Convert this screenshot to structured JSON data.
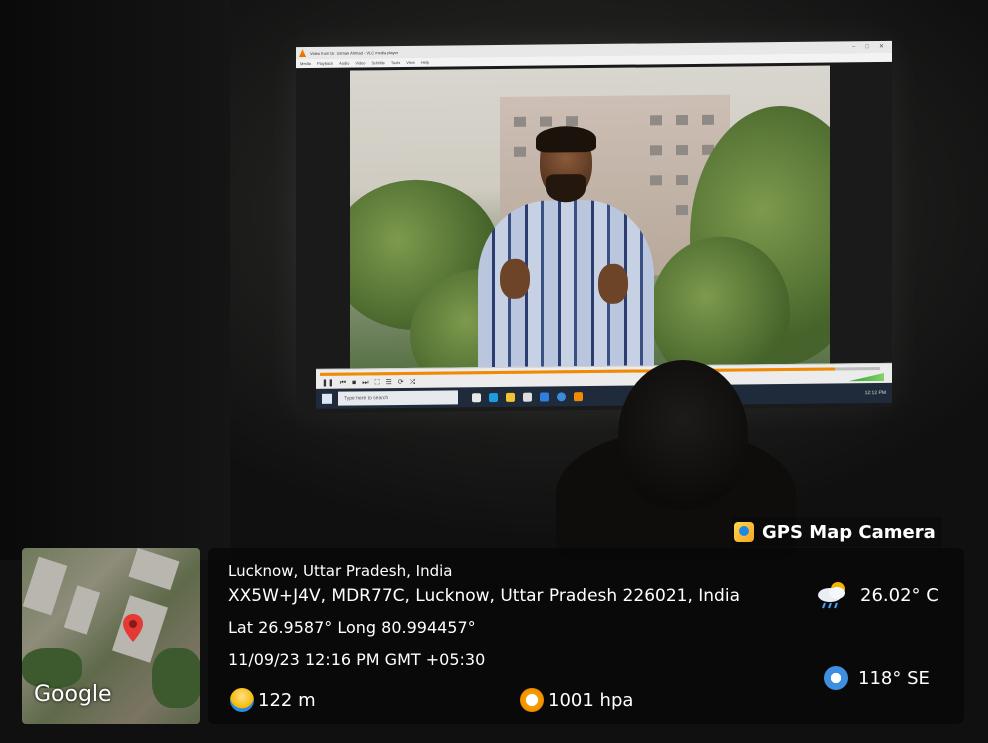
{
  "player": {
    "title": "Video from Dr. Usman Ahmad - VLC media player",
    "menu": [
      "Media",
      "Playback",
      "Audio",
      "Video",
      "Subtitle",
      "Tools",
      "View",
      "Help"
    ],
    "window_controls": [
      "–",
      "□",
      "✕"
    ],
    "progress": 0.92
  },
  "taskbar": {
    "search_placeholder": "Type here to search",
    "tray_text": "12:12 PM"
  },
  "overlay": {
    "brand": "GPS Map Camera",
    "map_label": "Google",
    "location_city": "Lucknow, Uttar Pradesh, India",
    "address": "XX5W+J4V, MDR77C, Lucknow, Uttar Pradesh 226021, India",
    "coordinates": "Lat 26.9587° Long 80.994457°",
    "datetime": "11/09/23 12:16 PM GMT +05:30",
    "altitude": "122 m",
    "pressure": "1001 hpa",
    "temperature": "26.02° C",
    "wind": "118° SE"
  },
  "colors": {
    "vlc_orange": "#f28a00",
    "pin_red": "#e53935",
    "panel_bg": "#080808",
    "text": "#ffffff"
  },
  "icons": {
    "brand": "gps-map-camera-icon",
    "altitude": "altitude-icon",
    "pressure": "pressure-gauge-icon",
    "weather": "cloud-rain-sun-icon",
    "wind": "wind-compass-icon",
    "pin": "map-pin-icon"
  }
}
